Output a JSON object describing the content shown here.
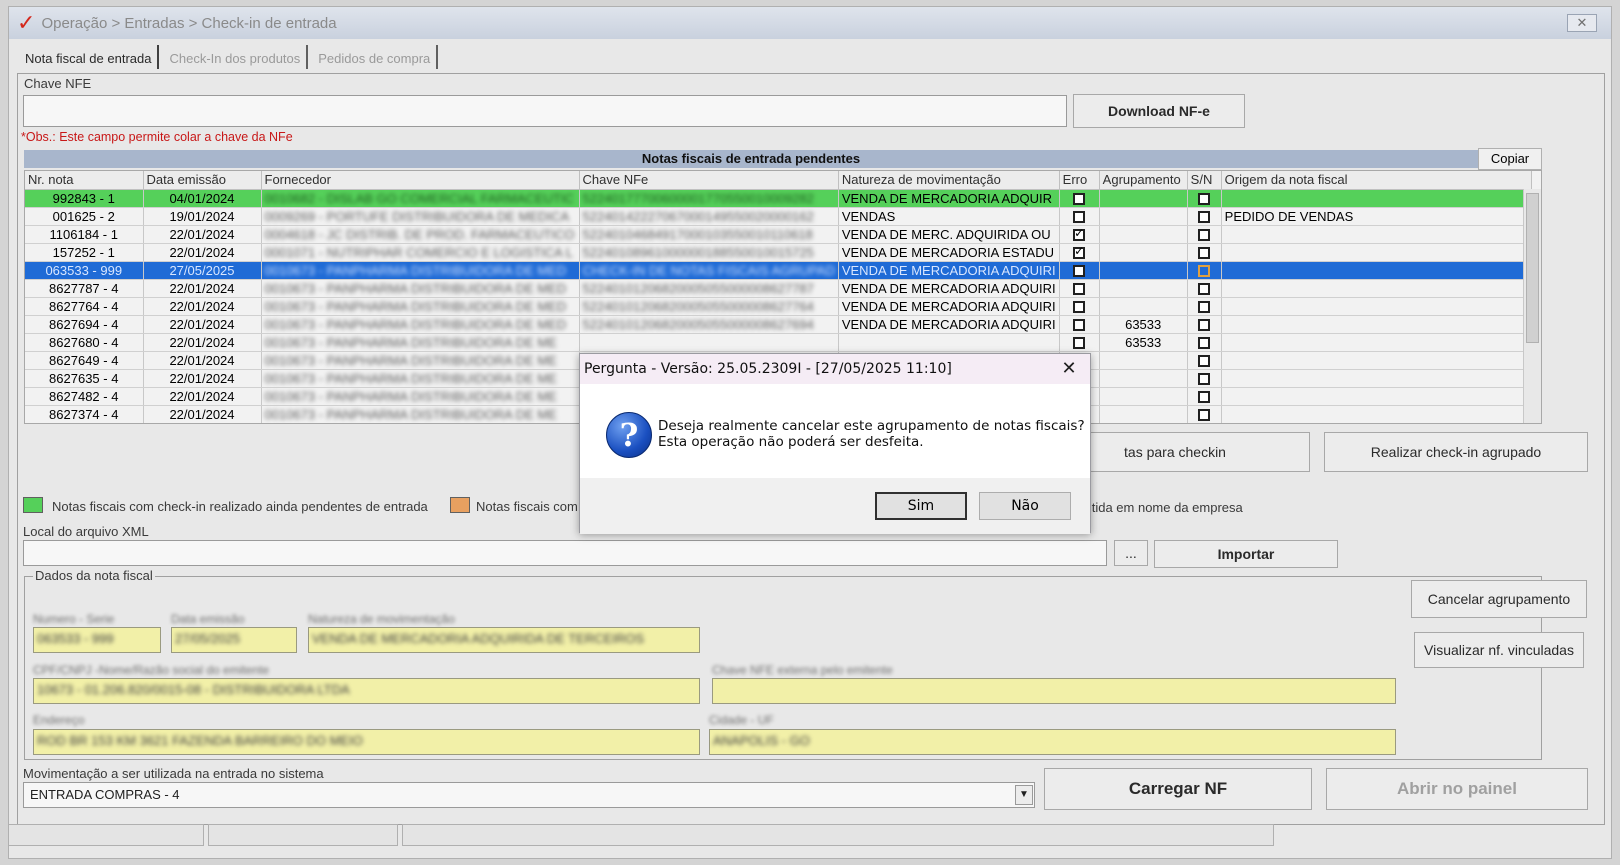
{
  "window": {
    "title": "Operação > Entradas > Check-in de entrada",
    "logo": "✓",
    "close": "✕"
  },
  "tabs": [
    "Nota fiscal de entrada",
    "Check-In dos produtos",
    "Pedidos de compra"
  ],
  "chave": {
    "label": "Chave NFE",
    "value": "",
    "download_label": "Download NF-e",
    "obs": "*Obs.: Este campo permite colar a chave da NFe"
  },
  "grid": {
    "title": "Notas fiscais de entrada pendentes",
    "copy_label": "Copiar",
    "columns": [
      "Nr. nota",
      "Data emissão",
      "Fornecedor",
      "Chave NFe",
      "Natureza de movimentação",
      "Erro",
      "Agrupamento",
      "S/N",
      "Origem da nota fiscal"
    ],
    "rows": [
      {
        "nr": "992843 - 1",
        "data": "04/01/2024",
        "fornecedor": "0010682 - DISLAB GO COMERCIAL FARMACEUTIC",
        "chave": "52240177700600001770550010009282",
        "natureza": "VENDA DE MERCADORIA ADQUIR",
        "erro": false,
        "agrup": "",
        "sn": false,
        "origem": "",
        "style": "green"
      },
      {
        "nr": "001625 - 2",
        "data": "19/01/2024",
        "fornecedor": "0009269 - PORTUFE DISTRIBUIDORA DE MEDICA",
        "chave": "52240142227067000149550020000162",
        "natureza": "VENDAS",
        "erro": false,
        "agrup": "",
        "sn": false,
        "origem": "PEDIDO DE VENDAS",
        "style": ""
      },
      {
        "nr": "1106184 - 1",
        "data": "22/01/2024",
        "fornecedor": "0004618 - JC DISTRIB. DE PROD. FARMACEUTICO",
        "chave": "52240104684917000103550010110618",
        "natureza": "VENDA DE MERC. ADQUIRIDA OU",
        "erro": true,
        "agrup": "",
        "sn": false,
        "origem": "",
        "style": ""
      },
      {
        "nr": "157252 - 1",
        "data": "22/01/2024",
        "fornecedor": "0001071 - NUTRIPHAR COMERCIO E LOGISTICA L",
        "chave": "52240108961000000188550010015725",
        "natureza": "VENDA DE MERCADORIA ESTADU",
        "erro": true,
        "agrup": "",
        "sn": false,
        "origem": "",
        "style": ""
      },
      {
        "nr": "063533 - 999",
        "data": "27/05/2025",
        "fornecedor": "0010673 - PANPHARMA DISTRIBUIDORA DE MED",
        "chave": "CHECK-IN DE NOTAS FISCAIS AGRUPAD",
        "natureza": "VENDA DE MERCADORIA ADQUIRI",
        "erro": false,
        "agrup": "",
        "sn": false,
        "origem": "",
        "style": "blue"
      },
      {
        "nr": "8627787 - 4",
        "data": "22/01/2024",
        "fornecedor": "0010673 - PANPHARMA DISTRIBUIDORA DE MED",
        "chave": "52240101206820005055000008627787",
        "natureza": "VENDA DE MERCADORIA ADQUIRI",
        "erro": false,
        "agrup": "",
        "sn": false,
        "origem": "",
        "style": ""
      },
      {
        "nr": "8627764 - 4",
        "data": "22/01/2024",
        "fornecedor": "0010673 - PANPHARMA DISTRIBUIDORA DE MED",
        "chave": "52240101206820005055000008627764",
        "natureza": "VENDA DE MERCADORIA ADQUIRI",
        "erro": false,
        "agrup": "",
        "sn": false,
        "origem": "",
        "style": ""
      },
      {
        "nr": "8627694 - 4",
        "data": "22/01/2024",
        "fornecedor": "0010673 - PANPHARMA DISTRIBUIDORA DE MED",
        "chave": "52240101206820005055000008627694",
        "natureza": "VENDA DE MERCADORIA ADQUIRI",
        "erro": false,
        "agrup": "63533",
        "sn": false,
        "origem": "",
        "style": ""
      },
      {
        "nr": "8627680 - 4",
        "data": "22/01/2024",
        "fornecedor": "0010673 - PANPHARMA DISTRIBUIDORA DE ME",
        "chave": "",
        "natureza": "",
        "erro": false,
        "agrup": "63533",
        "sn": false,
        "origem": "",
        "style": ""
      },
      {
        "nr": "8627649 - 4",
        "data": "22/01/2024",
        "fornecedor": "0010673 - PANPHARMA DISTRIBUIDORA DE ME",
        "chave": "",
        "natureza": "",
        "erro": false,
        "agrup": "",
        "sn": false,
        "origem": "",
        "style": ""
      },
      {
        "nr": "8627635 - 4",
        "data": "22/01/2024",
        "fornecedor": "0010673 - PANPHARMA DISTRIBUIDORA DE ME",
        "chave": "",
        "natureza": "",
        "erro": false,
        "agrup": "",
        "sn": false,
        "origem": "",
        "style": ""
      },
      {
        "nr": "8627482 - 4",
        "data": "22/01/2024",
        "fornecedor": "0010673 - PANPHARMA DISTRIBUIDORA DE ME",
        "chave": "",
        "natureza": "",
        "erro": false,
        "agrup": "",
        "sn": false,
        "origem": "",
        "style": ""
      },
      {
        "nr": "8627374 - 4",
        "data": "22/01/2024",
        "fornecedor": "0010673 - PANPHARMA DISTRIBUIDORA DE ME",
        "chave": "",
        "natureza": "",
        "erro": false,
        "agrup": "",
        "sn": false,
        "origem": "",
        "style": ""
      }
    ]
  },
  "actions": {
    "notas_checkin_partial": "tas para checkin",
    "checkin_agrupado": "Realizar check-in agrupado"
  },
  "legend": {
    "green_label": "Notas fiscais com check-in realizado ainda pendentes de entrada",
    "green_color": "#55d05a",
    "orange_label": "Notas fiscais com",
    "orange_color": "#e8a060",
    "third_partial": "mitida em nome da empresa"
  },
  "xml": {
    "label": "Local do arquivo XML",
    "value": "",
    "browse": "...",
    "import_label": "Importar"
  },
  "dados": {
    "title": "Dados da nota fiscal",
    "numero_label": "Numero - Serie",
    "numero_value": "063533 - 999",
    "data_label": "Data emissão",
    "data_value": "27/05/2025",
    "natureza_label": "Natureza de movimentação",
    "natureza_value": "VENDA DE MERCADORIA ADQUIRIDA DE TERCEIROS",
    "cpf_label": "CPF/CNPJ -Nome/Razão social do emitente",
    "cpf_value": "10673 - 01.206.820/0015-08 - DISTRIBUIDORA LTDA",
    "chave_label": "Chave NFE externa pelo emitente",
    "chave_value": "",
    "endereco_label": "Endereço",
    "endereco_value": "ROD BR 153 KM 3621 FAZENDA BARREIRO DO MEIO",
    "cidade_label": "Cidade - UF",
    "cidade_value": "ANAPOLIS - GO",
    "cancelar_label": "Cancelar agrupamento",
    "visualizar_label": "Visualizar nf. vinculadas"
  },
  "movimentacao": {
    "label": "Movimentação a ser utilizada na entrada no sistema",
    "value": "ENTRADA COMPRAS - 4",
    "carregar_label": "Carregar NF",
    "abrir_label": "Abrir no painel"
  },
  "dialog": {
    "title": "Pergunta - Versão: 25.05.2309I - [27/05/2025 11:10]",
    "close": "✕",
    "icon": "?",
    "line1": "Deseja realmente cancelar este agrupamento de notas fiscais?",
    "line2": "Esta operação não poderá ser desfeita.",
    "yes": "Sim",
    "no": "Não"
  }
}
